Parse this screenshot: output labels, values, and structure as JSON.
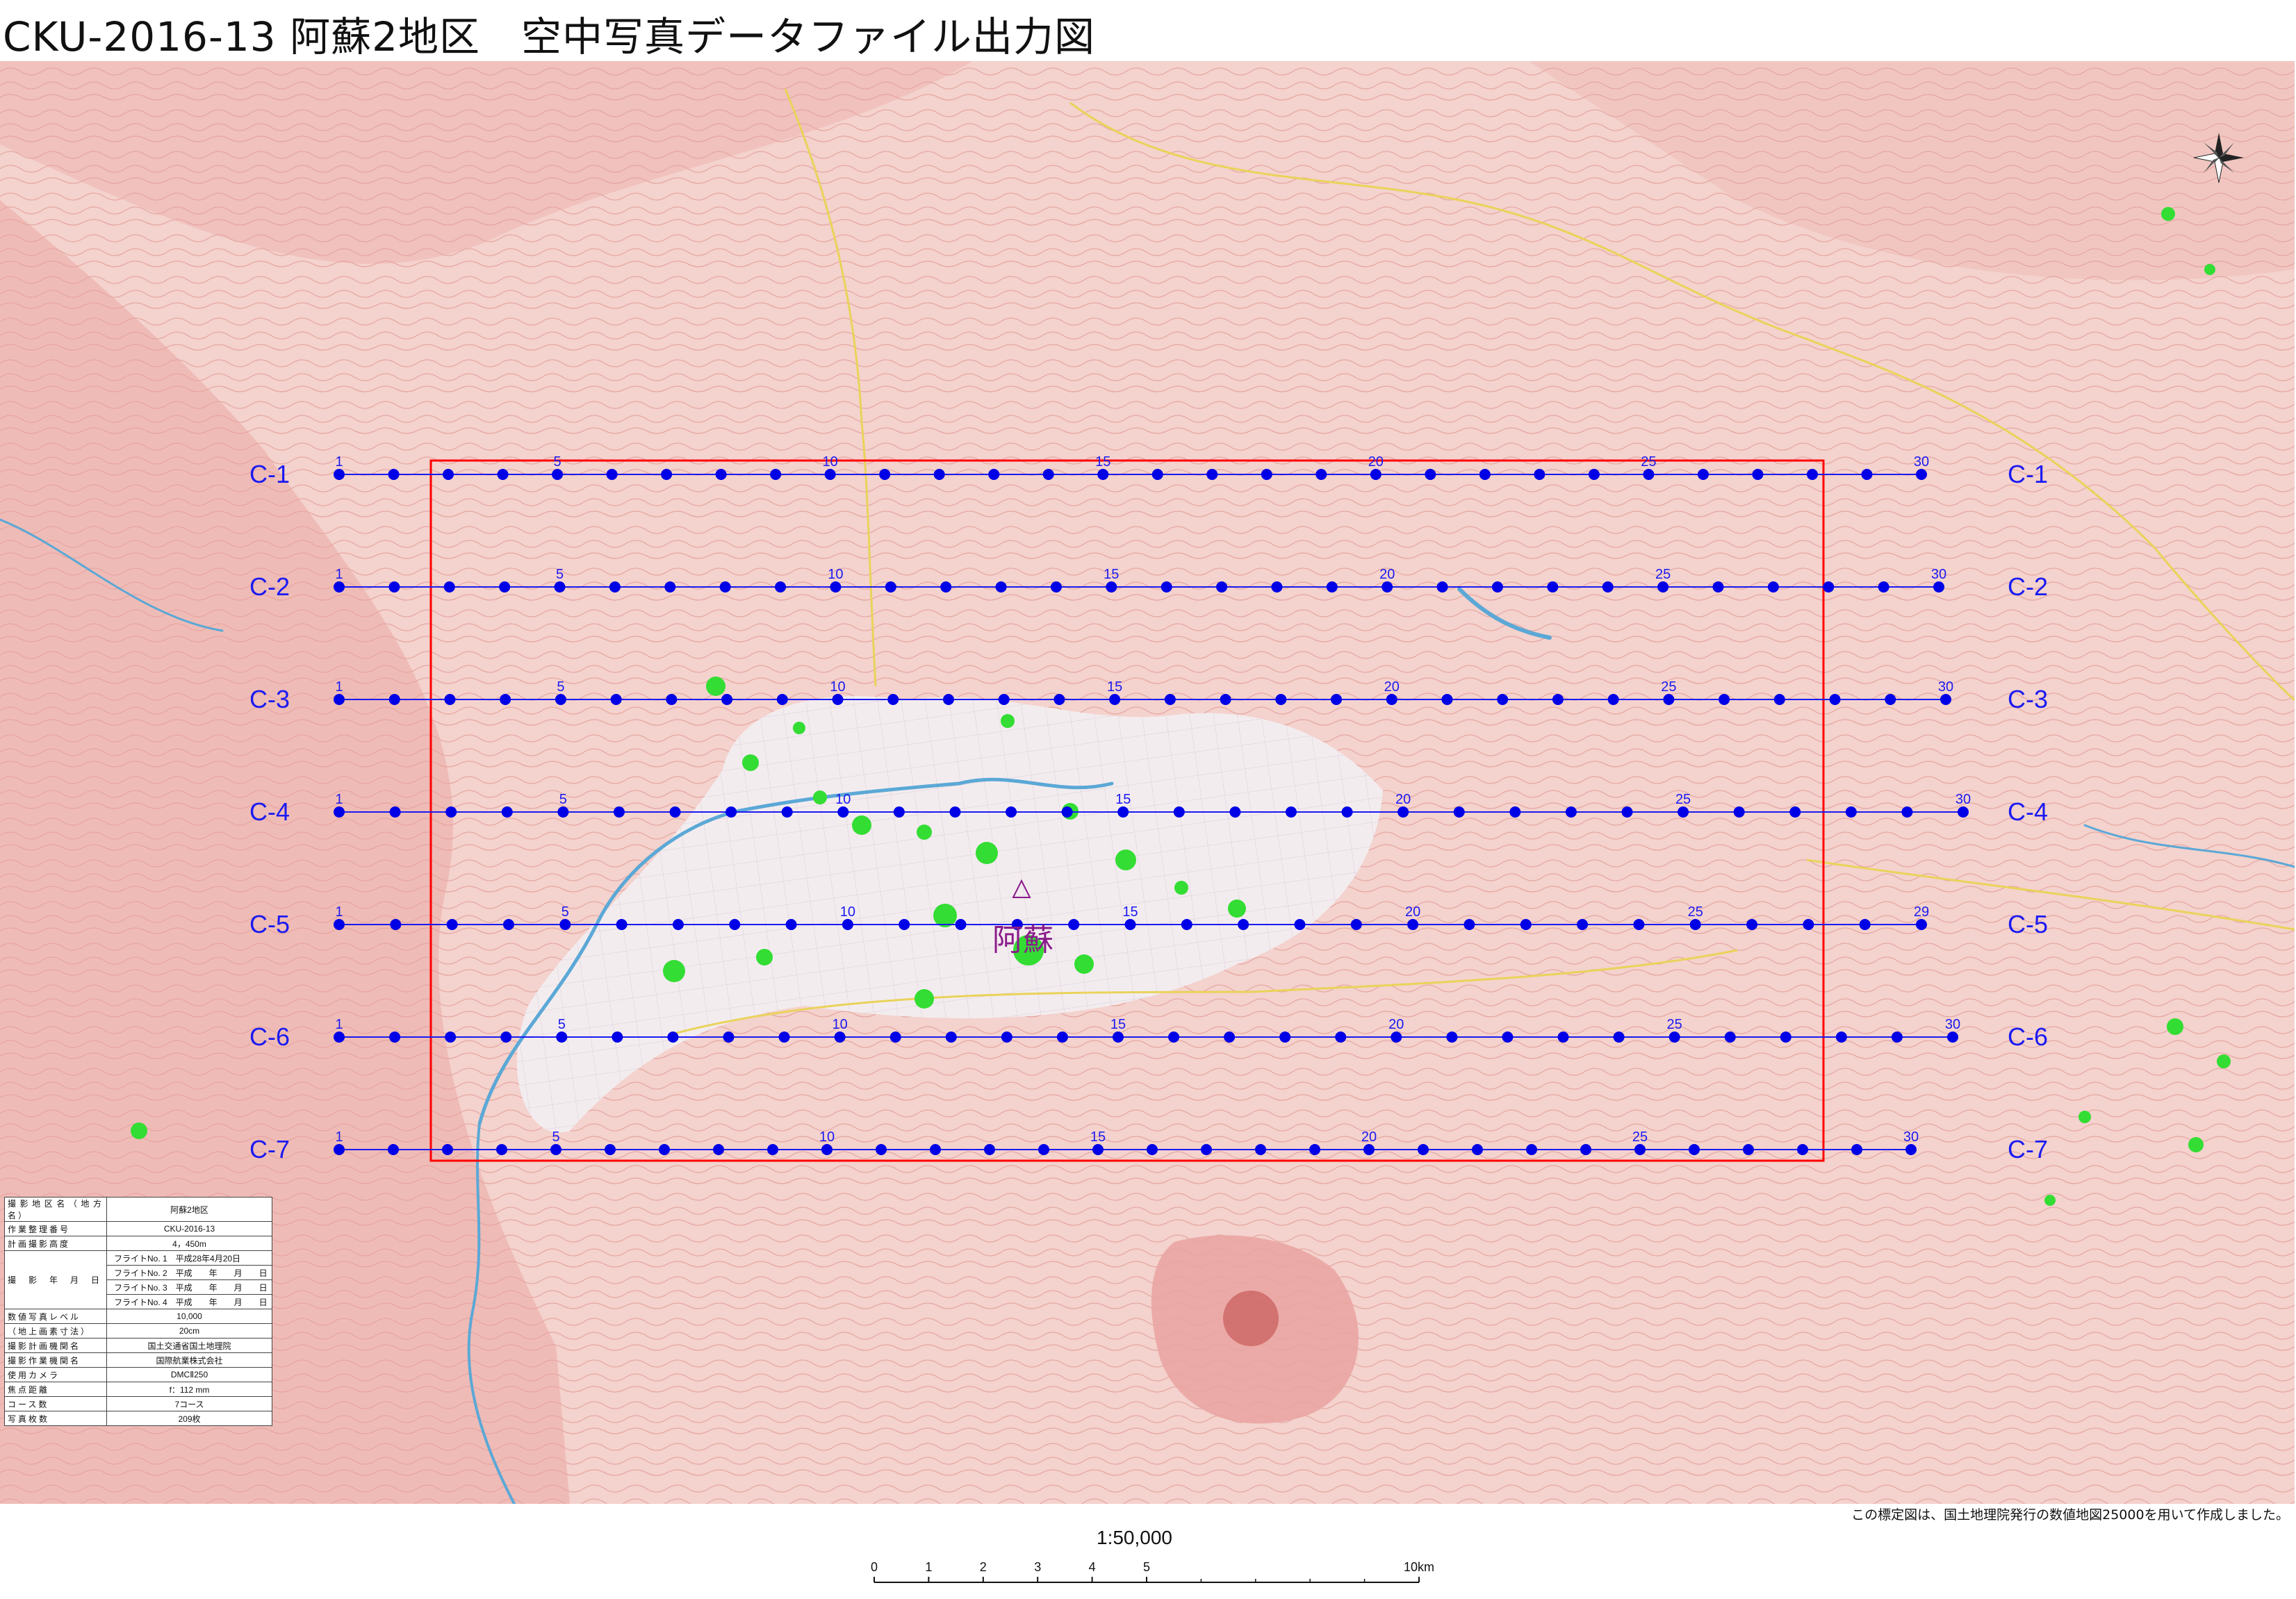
{
  "title": "CKU-2016-13 阿蘇2地区　空中写真データファイル出力図",
  "colors": {
    "relief": "#e9a3a0",
    "relief_light": "#f4d2cd",
    "lowland": "#f3ecef",
    "river": "#5ba8d6",
    "road": "#e9d35a",
    "flight_line": "#1a1af2",
    "photo_point": "#0000e6",
    "area_frame": "#ff0000",
    "forest_patch": "#33dd33",
    "place_label": "#8a1a8a"
  },
  "place_name": "阿蘇",
  "north_arrow": "compass-rose-icon",
  "courses": [
    {
      "id": "C-1",
      "last": 30
    },
    {
      "id": "C-2",
      "last": 30
    },
    {
      "id": "C-3",
      "last": 30
    },
    {
      "id": "C-4",
      "last": 30
    },
    {
      "id": "C-5",
      "last": 29
    },
    {
      "id": "C-6",
      "last": 30
    },
    {
      "id": "C-7",
      "last": 30
    }
  ],
  "info_table": [
    {
      "key": "撮影地区名（地方名）",
      "value": "阿蘇2地区"
    },
    {
      "key": "作業整理番号",
      "value": "CKU-2016-13"
    },
    {
      "key": "計画撮影高度",
      "value": "4，450m"
    },
    {
      "key": "撮　影　年　月　日",
      "value": "フライトNo. 1　平成28年4月20日",
      "sub": [
        "フライトNo. 2　平成　　年　　月　　日",
        "フライトNo. 3　平成　　年　　月　　日",
        "フライトNo. 4　平成　　年　　月　　日"
      ]
    },
    {
      "key": "数値写真レベル",
      "value": "10,000"
    },
    {
      "key": "（地上画素寸法）",
      "value": "20cm"
    },
    {
      "key": "撮影計画機関名",
      "value": "国土交通省国土地理院"
    },
    {
      "key": "撮影作業機関名",
      "value": "国際航業株式会社"
    },
    {
      "key": "使用カメラ",
      "value": "DMCⅡ250"
    },
    {
      "key": "焦点距離",
      "value": "f：112 mm"
    },
    {
      "key": "コース数",
      "value": "7コース"
    },
    {
      "key": "写真枚数",
      "value": "209枚"
    }
  ],
  "credit": "この標定図は、国土地理院発行の数値地図25000を用いて作成しました。",
  "scale_ratio": "1:50,000",
  "scale_labels": [
    "0",
    "1",
    "2",
    "3",
    "4",
    "5",
    "10km"
  ]
}
